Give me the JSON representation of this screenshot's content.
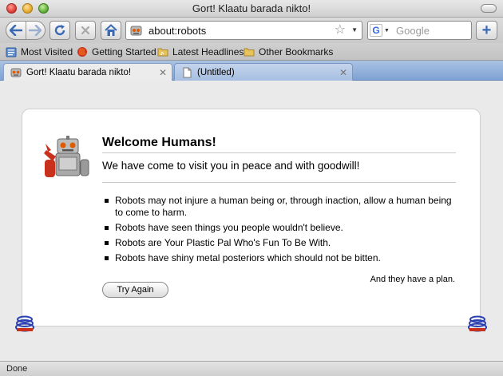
{
  "window": {
    "title": "Gort! Klaatu barada nikto!"
  },
  "toolbar": {
    "url": "about:robots",
    "search_placeholder": "Google",
    "search_engine_letter": "G",
    "new_tab_label": "+"
  },
  "bookmarks": [
    {
      "label": "Most Visited",
      "icon": "bookmarks-icon"
    },
    {
      "label": "Getting Started",
      "icon": "firefox-icon"
    },
    {
      "label": "Latest Headlines",
      "icon": "rss-folder-icon"
    },
    {
      "label": "Other Bookmarks",
      "icon": "folder-icon"
    }
  ],
  "tabs": [
    {
      "title": "Gort! Klaatu barada nikto!",
      "active": true
    },
    {
      "title": "(Untitled)",
      "active": false
    }
  ],
  "page": {
    "heading": "Welcome Humans!",
    "tagline": "We have come to visit you in peace and with goodwill!",
    "laws": [
      "Robots may not injure a human being or, through inaction, allow a human being to come to harm.",
      "Robots have seen things you people wouldn't believe.",
      "Robots are Your Plastic Pal Who's Fun To Be With.",
      "Robots have shiny metal posteriors which should not be bitten."
    ],
    "plan": "And they have a plan.",
    "button_label": "Try Again"
  },
  "status": {
    "text": "Done"
  },
  "colors": {
    "tab_strip": "#8aaad9",
    "accent": "#3b6ab5"
  }
}
